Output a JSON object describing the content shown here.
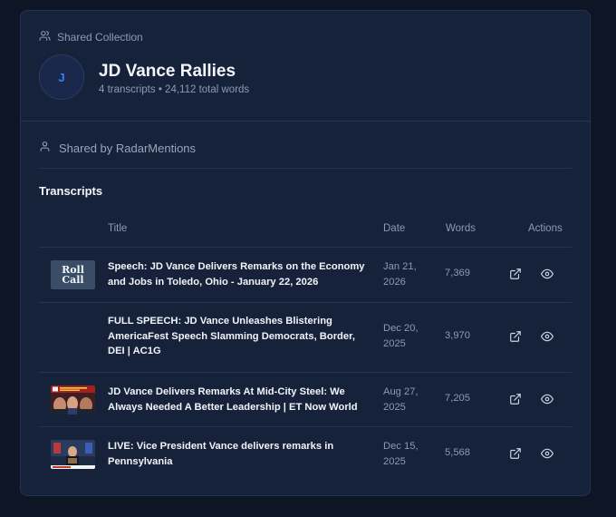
{
  "header": {
    "kicker": "Shared Collection",
    "avatar_initial": "J",
    "title": "JD Vance Rallies",
    "subtitle": "4 transcripts • 24,112 total words"
  },
  "shared_by": "Shared by RadarMentions",
  "section_title": "Transcripts",
  "columns": {
    "title": "Title",
    "date": "Date",
    "words": "Words",
    "actions": "Actions"
  },
  "rows": [
    {
      "title": "Speech: JD Vance Delivers Remarks on the Economy and Jobs in Toledo, Ohio - January 22, 2026",
      "date": "Jan 21, 2026",
      "words": "7,369",
      "thumb_text": "Roll Call"
    },
    {
      "title": "FULL SPEECH: JD Vance Unleashes Blistering AmericaFest Speech Slamming Democrats, Border, DEI | AC1G",
      "date": "Dec 20, 2025",
      "words": "3,970"
    },
    {
      "title": "JD Vance Delivers Remarks At Mid-City Steel: We Always Needed A Better Leadership | ET Now World",
      "date": "Aug 27, 2025",
      "words": "7,205"
    },
    {
      "title": "LIVE: Vice President Vance delivers remarks in Pennsylvania",
      "date": "Dec 15, 2025",
      "words": "5,568"
    }
  ],
  "icons": {
    "open": "external-link-icon",
    "view": "eye-icon",
    "people": "users-icon",
    "person": "user-icon"
  },
  "colors": {
    "background": "#0e1626",
    "card": "#16223a",
    "accent": "#3b7cf5"
  }
}
